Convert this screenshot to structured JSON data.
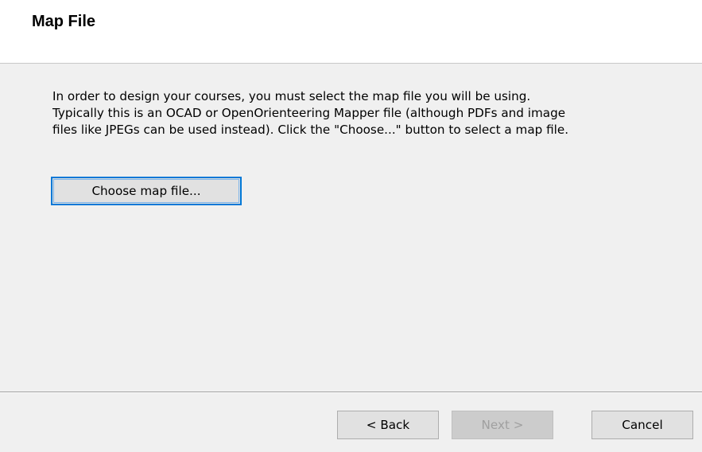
{
  "header": {
    "title": "Map File"
  },
  "content": {
    "instructions": [
      "In order to design your courses, you must select the map file you will be using.",
      "Typically this is an OCAD or OpenOrienteering Mapper file (although PDFs and image",
      "files like JPEGs can be used instead). Click the \"Choose...\" button to select a map file."
    ],
    "choose_button_label": "Choose map file..."
  },
  "footer": {
    "back_label": "< Back",
    "next_label": "Next >",
    "next_enabled": false,
    "cancel_label": "Cancel"
  },
  "colors": {
    "header_bg": "#ffffff",
    "dialog_bg": "#f0f0f0",
    "focus_border": "#0078d7",
    "disabled_text": "#a0a0a0"
  }
}
